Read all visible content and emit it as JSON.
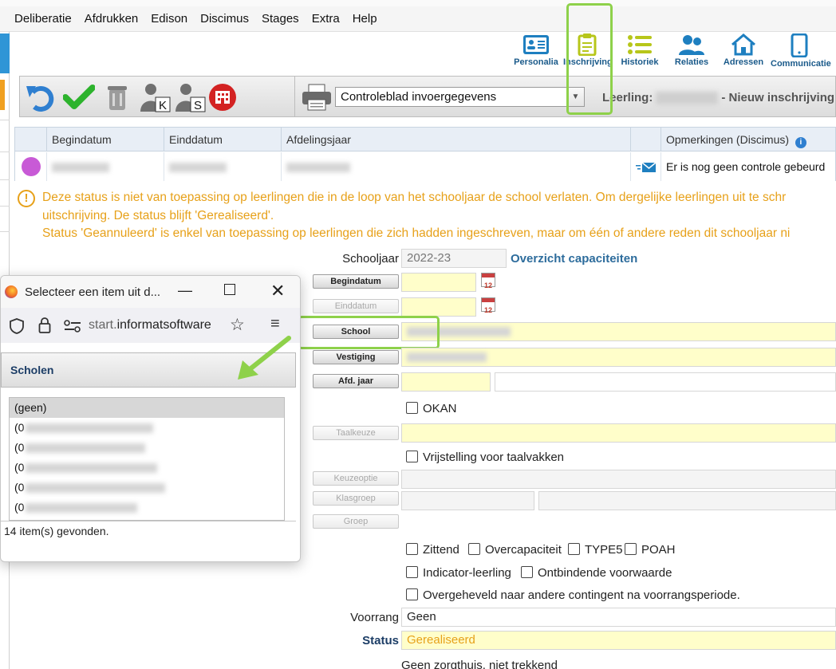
{
  "menu": [
    "Deliberatie",
    "Afdrukken",
    "Edison",
    "Discimus",
    "Stages",
    "Extra",
    "Help"
  ],
  "nav": [
    {
      "label": "Personalia",
      "icon": "personalia-card-icon",
      "color": "#1e7fc0"
    },
    {
      "label": "Inschrijving",
      "icon": "clipboard-icon",
      "color": "#b7c61a"
    },
    {
      "label": "Historiek",
      "icon": "list-icon",
      "color": "#b7c61a"
    },
    {
      "label": "Relaties",
      "icon": "people-icon",
      "color": "#1e7fc0"
    },
    {
      "label": "Adressen",
      "icon": "house-icon",
      "color": "#1e7fc0"
    },
    {
      "label": "Communicatie",
      "icon": "phone-icon",
      "color": "#1e7fc0"
    }
  ],
  "toolbar": {
    "buttons": [
      "undo-icon",
      "check-icon",
      "trash-icon",
      "user-k-icon",
      "user-s-icon",
      "building-icon"
    ],
    "report_select": "Controleblad invoergegevens",
    "leerling_label": "Leerling:",
    "leerling_suffix": "- Nieuw inschrijving"
  },
  "grid": {
    "columns": [
      "Begindatum",
      "Einddatum",
      "Afdelingsjaar",
      "Opmerkingen (Discimus)"
    ],
    "row": {
      "opmerking": "Er is nog geen controle gebeurd"
    }
  },
  "warning": {
    "line1": "Deze status is niet van toepassing op leerlingen die in de loop van het schooljaar de school verlaten. Om dergelijke leerlingen uit te schr",
    "line2": "uitschrijving. De status blijft 'Gerealiseerd'.",
    "line3": "Status 'Geannuleerd' is enkel van toepassing op leerlingen die zich hadden ingeschreven, maar om één of andere reden dit schooljaar ni"
  },
  "form": {
    "schooljaar_label": "Schooljaar",
    "schooljaar_value": "2022-23",
    "overzicht_link": "Overzicht capaciteiten",
    "btn_begindatum": "Begindatum",
    "btn_einddatum": "Einddatum",
    "btn_school": "School",
    "btn_vestiging": "Vestiging",
    "btn_afdjaar": "Afd. jaar",
    "cb_okan": "OKAN",
    "btn_taalkeuze": "Taalkeuze",
    "cb_vrijstelling": "Vrijstelling voor taalvakken",
    "btn_keuzeoptie": "Keuzeoptie",
    "btn_klasgroep": "Klasgroep",
    "btn_groep": "Groep",
    "cb_zittend": "Zittend",
    "cb_overcapaciteit": "Overcapaciteit",
    "cb_type5": "TYPE5",
    "cb_poah": "POAH",
    "cb_indicator": "Indicator-leerling",
    "cb_ontbindende": "Ontbindende voorwaarde",
    "cb_overgeheveld": "Overgeheveld naar andere contingent na voorrangsperiode.",
    "voorrang_label": "Voorrang",
    "voorrang_value": "Geen",
    "status_label": "Status",
    "status_value": "Gerealiseerd",
    "bottom_text": "Geen zorgthuis, niet trekkend"
  },
  "popup": {
    "title": "Selecteer een item uit d...",
    "url_prefix": "start.",
    "url_domain": "informatsoftware",
    "list_header": "Scholen",
    "items": [
      "(geen)",
      "(0",
      "(0",
      "(0",
      "(0",
      "(0"
    ],
    "found_text": "14 item(s) gevonden."
  },
  "colors": {
    "highlight": "#8ed14a",
    "warning": "#e7a11a",
    "field_yellow": "#fffeca"
  }
}
